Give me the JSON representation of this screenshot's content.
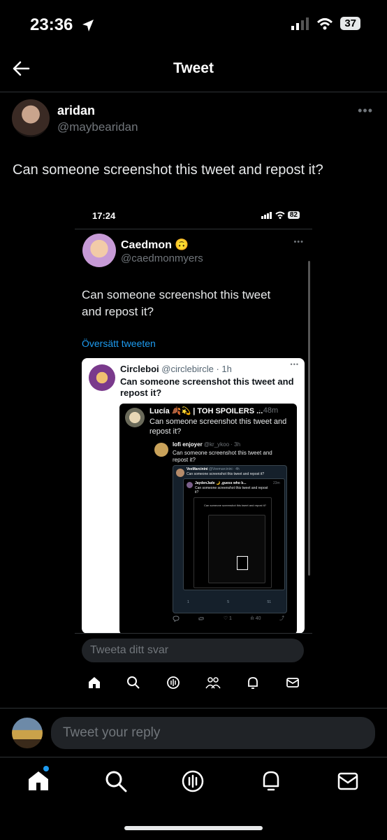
{
  "status": {
    "time": "23:36",
    "battery": "37"
  },
  "header": {
    "title": "Tweet"
  },
  "tweet": {
    "name": "aridan",
    "handle": "@maybearidan",
    "text": "Can someone screenshot this tweet and repost it?"
  },
  "screenshot": {
    "time": "17:24",
    "battery": "82",
    "tweet": {
      "name": "Caedmon 🙃",
      "handle": "@caedmonmyers",
      "text": "Can someone screenshot this tweet and repost it?",
      "translate": "Översätt tweeten"
    },
    "quote": {
      "name": "Circleboi",
      "handle": "@circlebircle · 1h",
      "text": "Can someone screenshot this tweet and repost it?"
    },
    "nested1": {
      "name": "Lucía 🍂💫 | TOH SPOILERS ...",
      "time": "· 48m",
      "text": "Can someone screenshot this tweet and repost it?"
    },
    "nested2": {
      "name": "lofi enjoyer",
      "handle": "@kr_ykoo · 3h",
      "text": "Can someone screenshot this tweet and repost it?"
    },
    "nested3": {
      "name": "VeeMarcinini",
      "handle": "@Veemarcinini · 4h",
      "text": "Can someone screenshot this tweet and repost it?"
    },
    "nested4": {
      "name": "JaydenJade 🌙 ,guess who b...",
      "time": "23m",
      "text": "Can someone screenshot this tweet and repost it?"
    },
    "nested5": {
      "text": "Can someone screenshot this tweet and repost it?"
    },
    "actions": {
      "likes": "1",
      "views": "40"
    },
    "deep_actions": {
      "replies": "1",
      "likes": "5",
      "views": "51"
    },
    "reply_placeholder": "Tweeta ditt svar"
  },
  "reply": {
    "placeholder": "Tweet your reply"
  },
  "tabbar": {
    "items": [
      "home-icon",
      "search-icon",
      "spaces-icon",
      "notifications-icon",
      "messages-icon"
    ]
  }
}
